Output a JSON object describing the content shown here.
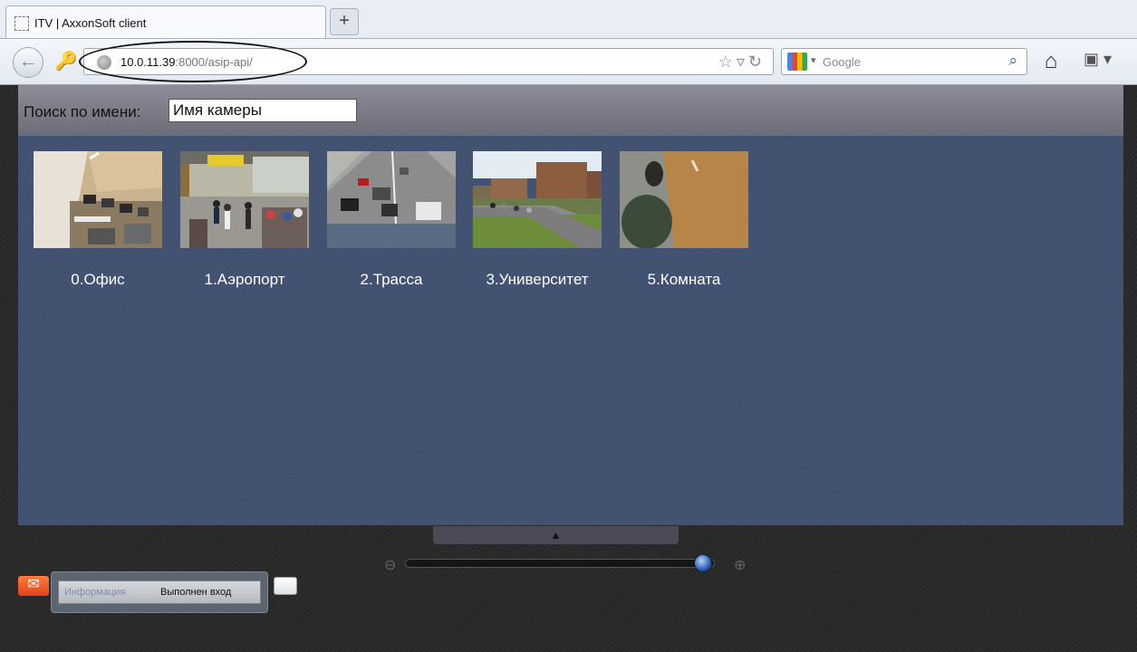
{
  "browser": {
    "tab_title": "ITV | AxxonSoft client",
    "new_tab_label": "+",
    "url_host": "10.0.11.39",
    "url_rest": ":8000/asip-api/",
    "search_engine": "Google"
  },
  "search": {
    "label": "Поиск по имени:",
    "value": "Имя камеры"
  },
  "cameras": [
    {
      "name": "0.Офис"
    },
    {
      "name": "1.Аэропорт"
    },
    {
      "name": "2.Трасса"
    },
    {
      "name": "3.Университет"
    },
    {
      "name": "5.Комната"
    }
  ],
  "zoom": {
    "level": 1.0
  },
  "status": {
    "key": "Информация",
    "value": "Выполнен вход"
  },
  "colors": {
    "camera_area": "#455272",
    "search_bar": "#7d7d89",
    "mail_button": "#f25a2a"
  }
}
